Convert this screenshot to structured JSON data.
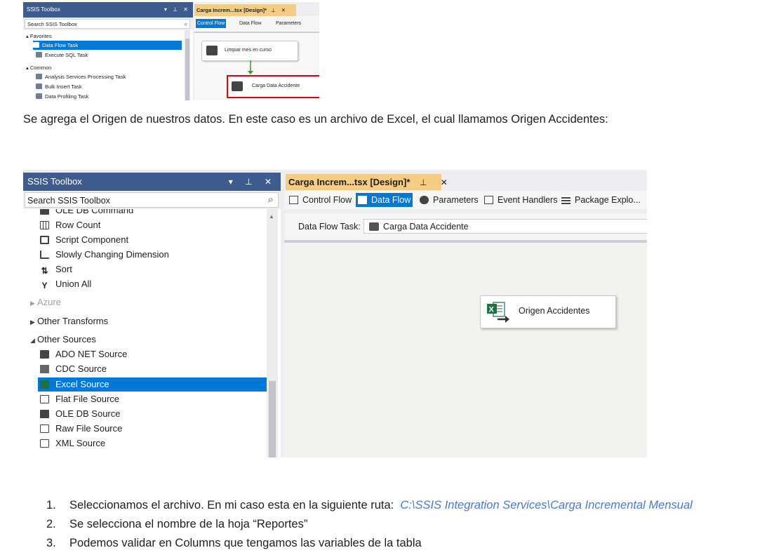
{
  "screenshot1": {
    "toolbox": {
      "title": "SSIS Toolbox",
      "controls": "▾ ⊥ ✕",
      "search_placeholder": "Search SSIS Toolbox",
      "groups": [
        {
          "label": "Favorites",
          "items": [
            "Data Flow Task",
            "Execute SQL Task"
          ],
          "selected": "Data Flow Task"
        },
        {
          "label": "Common",
          "items": [
            "Analysis Services Processing Task",
            "Bulk Insert Task",
            "Data Profiling Task"
          ]
        }
      ]
    },
    "designer": {
      "tab_label": "Carga Increm...tsx [Design]*",
      "tab_controls": "⊥ ✕",
      "toolbar": [
        "Control Flow",
        "Data Flow",
        "Parameters"
      ],
      "active_tab": "Control Flow",
      "tasks": [
        "Limpiar mes en curso",
        "Carga Data Accidente"
      ],
      "highlight_color": "#e3000f"
    }
  },
  "paragraph": "Se agrega el Origen de nuestros datos. En este caso es un archivo de Excel, el cual llamamos Origen Accidentes:",
  "screenshot2": {
    "toolbox": {
      "title": "SSIS Toolbox",
      "controls": "▾ ⊥ ✕",
      "search_placeholder": "Search SSIS Toolbox",
      "items_top": [
        "OLE DB Command",
        "Row Count",
        "Script Component",
        "Slowly Changing Dimension",
        "Sort",
        "Union All"
      ],
      "group_azure": "Azure",
      "group_other_transforms": "Other Transforms",
      "group_other_sources": "Other Sources",
      "items_sources": [
        "ADO NET Source",
        "CDC Source",
        "Excel Source",
        "Flat File Source",
        "OLE DB Source",
        "Raw File Source",
        "XML Source"
      ],
      "selected": "Excel Source"
    },
    "designer": {
      "tab_label": "Carga Increm...tsx [Design]*",
      "tab_controls": "⊥ ✕",
      "toolbar": [
        "Control Flow",
        "Data Flow",
        "Parameters",
        "Event Handlers",
        "Package Explo..."
      ],
      "active_tab": "Data Flow",
      "task_label": "Data Flow Task:",
      "task_value": "Carga Data Accidente",
      "component": "Origen Accidentes"
    }
  },
  "steps": [
    {
      "num": "1.",
      "text": "Seleccionamos el archivo. En mi caso esta en la siguiente ruta:",
      "path": "C:\\SSIS Integration Services\\Carga Incremental Mensual"
    },
    {
      "num": "2.",
      "text": "Se selecciona el nombre de la hoja “Reportes”"
    },
    {
      "num": "3.",
      "text": "Podemos validar en Columns que tengamos las variables de la tabla"
    }
  ],
  "colors": {
    "selection": "#0078d7",
    "toolbox_title": "#3f5c8f",
    "doc_tab": "#f5cc84",
    "path_link": "#4a7ac8"
  }
}
